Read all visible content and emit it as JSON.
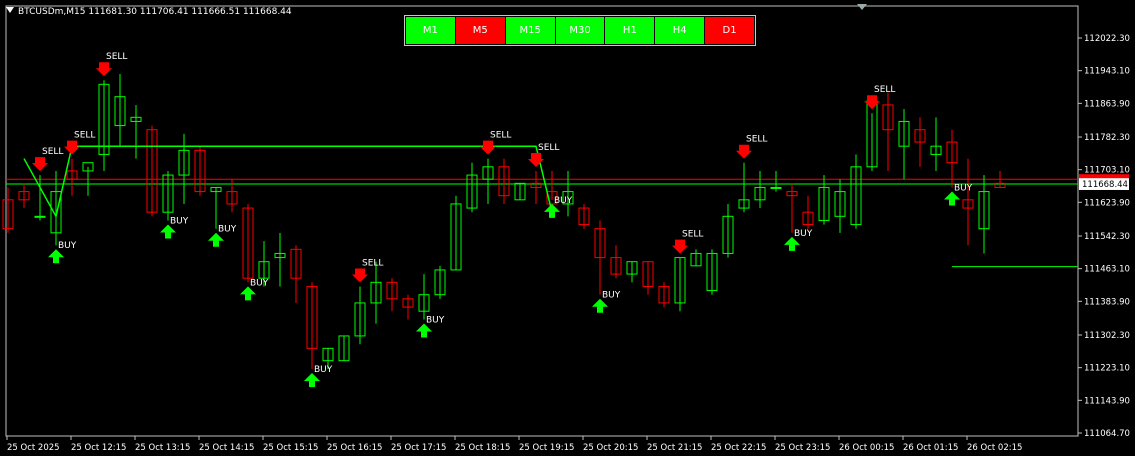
{
  "header": {
    "symbol_info": "BTCUSDm,M15  111681.30 111706.41 111666.51 111668.44"
  },
  "timeframes": [
    {
      "label": "M1",
      "color": "#00ff00"
    },
    {
      "label": "M5",
      "color": "#ff0000"
    },
    {
      "label": "M15",
      "color": "#00ff00"
    },
    {
      "label": "M30",
      "color": "#00ff00"
    },
    {
      "label": "H1",
      "color": "#00ff00"
    },
    {
      "label": "H4",
      "color": "#00ff00"
    },
    {
      "label": "D1",
      "color": "#ff0000"
    }
  ],
  "colors": {
    "background": "#000000",
    "bull": "#00ff00",
    "bear": "#ff0000",
    "buy_arrow": "#00ff00",
    "sell_arrow": "#ff0000",
    "axis": "#c0c0c0",
    "price_line": "#00ff00",
    "bid_line": "#ff0000"
  },
  "chart_data": {
    "type": "candlestick",
    "y_ticks": [
      "112022.30",
      "111943.10",
      "111863.90",
      "111782.30",
      "111703.10",
      "111623.90",
      "111542.30",
      "111463.10",
      "111383.90",
      "111302.30",
      "111223.10",
      "111143.90",
      "111064.70"
    ],
    "x_ticks": [
      "25 Oct 2025",
      "25 Oct 12:15",
      "25 Oct 13:15",
      "25 Oct 14:15",
      "25 Oct 15:15",
      "25 Oct 16:15",
      "25 Oct 17:15",
      "25 Oct 18:15",
      "25 Oct 19:15",
      "25 Oct 20:15",
      "25 Oct 21:15",
      "25 Oct 22:15",
      "25 Oct 23:15",
      "26 Oct 00:15",
      "26 Oct 01:15",
      "26 Oct 02:15"
    ],
    "ylim": [
      111064.7,
      112022.3
    ],
    "current_price": "111668.44",
    "bid_price": "111680",
    "candles": [
      [
        111630,
        111660,
        111550,
        111560
      ],
      [
        111650,
        111670,
        111610,
        111630
      ],
      [
        111590,
        111690,
        111580,
        111590
      ],
      [
        111550,
        111700,
        111520,
        111650
      ],
      [
        111700,
        111730,
        111640,
        111680
      ],
      [
        111700,
        111710,
        111640,
        111720
      ],
      [
        111740,
        111920,
        111700,
        111910
      ],
      [
        111810,
        111935,
        111760,
        111880
      ],
      [
        111820,
        111860,
        111730,
        111830
      ],
      [
        111800,
        111810,
        111590,
        111600
      ],
      [
        111600,
        111700,
        111580,
        111690
      ],
      [
        111690,
        111790,
        111620,
        111750
      ],
      [
        111750,
        111760,
        111640,
        111650
      ],
      [
        111650,
        111660,
        111560,
        111660
      ],
      [
        111650,
        111680,
        111600,
        111620
      ],
      [
        111610,
        111620,
        111430,
        111440
      ],
      [
        111440,
        111530,
        111420,
        111480
      ],
      [
        111490,
        111550,
        111420,
        111500
      ],
      [
        111510,
        111520,
        111380,
        111440
      ],
      [
        111420,
        111430,
        111220,
        111270
      ],
      [
        111240,
        111270,
        111220,
        111270
      ],
      [
        111240,
        111300,
        111240,
        111300
      ],
      [
        111300,
        111420,
        111280,
        111380
      ],
      [
        111380,
        111480,
        111330,
        111430
      ],
      [
        111430,
        111440,
        111360,
        111390
      ],
      [
        111390,
        111400,
        111340,
        111370
      ],
      [
        111360,
        111450,
        111340,
        111400
      ],
      [
        111400,
        111470,
        111390,
        111460
      ],
      [
        111460,
        111640,
        111460,
        111620
      ],
      [
        111610,
        111720,
        111600,
        111690
      ],
      [
        111680,
        111730,
        111620,
        111710
      ],
      [
        111710,
        111730,
        111620,
        111640
      ],
      [
        111630,
        111670,
        111630,
        111670
      ],
      [
        111670,
        111700,
        111620,
        111660
      ],
      [
        111650,
        111700,
        111630,
        111620
      ],
      [
        111620,
        111700,
        111590,
        111650
      ],
      [
        111610,
        111620,
        111560,
        111570
      ],
      [
        111560,
        111580,
        111400,
        111490
      ],
      [
        111490,
        111520,
        111440,
        111450
      ],
      [
        111450,
        111480,
        111430,
        111480
      ],
      [
        111480,
        111480,
        111400,
        111420
      ],
      [
        111420,
        111430,
        111370,
        111380
      ],
      [
        111380,
        111490,
        111360,
        111490
      ],
      [
        111470,
        111510,
        111470,
        111500
      ],
      [
        111410,
        111510,
        111400,
        111500
      ],
      [
        111500,
        111620,
        111490,
        111590
      ],
      [
        111610,
        111720,
        111600,
        111630
      ],
      [
        111630,
        111700,
        111610,
        111660
      ],
      [
        111660,
        111700,
        111650,
        111660
      ],
      [
        111650,
        111670,
        111550,
        111640
      ],
      [
        111600,
        111640,
        111560,
        111570
      ],
      [
        111580,
        111690,
        111570,
        111660
      ],
      [
        111590,
        111680,
        111550,
        111650
      ],
      [
        111570,
        111740,
        111560,
        111710
      ],
      [
        111710,
        111840,
        111700,
        111870
      ],
      [
        111860,
        111890,
        111700,
        111800
      ],
      [
        111760,
        111850,
        111680,
        111820
      ],
      [
        111800,
        111830,
        111710,
        111770
      ],
      [
        111740,
        111830,
        111700,
        111760
      ],
      [
        111770,
        111800,
        111660,
        111720
      ],
      [
        111630,
        111730,
        111520,
        111610
      ],
      [
        111560,
        111690,
        111500,
        111650
      ],
      [
        111670,
        111700,
        111660,
        111660
      ]
    ],
    "signals": [
      {
        "i": 2,
        "type": "sell",
        "label": "SELL"
      },
      {
        "i": 3,
        "type": "buy",
        "label": "BUY"
      },
      {
        "i": 4,
        "type": "sell",
        "label": "SELL"
      },
      {
        "i": 6,
        "type": "sell",
        "label": "SELL"
      },
      {
        "i": 10,
        "type": "buy",
        "label": "BUY"
      },
      {
        "i": 13,
        "type": "buy",
        "label": "BUY"
      },
      {
        "i": 15,
        "type": "buy",
        "label": "BUY"
      },
      {
        "i": 19,
        "type": "buy",
        "label": "BUY"
      },
      {
        "i": 22,
        "type": "sell",
        "label": "SELL"
      },
      {
        "i": 26,
        "type": "buy",
        "label": "BUY"
      },
      {
        "i": 30,
        "type": "sell",
        "label": "SELL"
      },
      {
        "i": 33,
        "type": "sell",
        "label": "SELL"
      },
      {
        "i": 34,
        "type": "buy",
        "label": "BUY"
      },
      {
        "i": 37,
        "type": "buy",
        "label": "BUY"
      },
      {
        "i": 42,
        "type": "sell",
        "label": "SELL"
      },
      {
        "i": 46,
        "type": "sell",
        "label": "SELL"
      },
      {
        "i": 49,
        "type": "buy",
        "label": "BUY"
      },
      {
        "i": 54,
        "type": "sell",
        "label": "SELL"
      },
      {
        "i": 59,
        "type": "buy",
        "label": "BUY"
      }
    ],
    "zigzag": [
      [
        1,
        111730
      ],
      [
        3,
        111590
      ],
      [
        4,
        111760
      ],
      [
        33,
        111760
      ],
      [
        34,
        111600
      ]
    ],
    "buy_level": {
      "start": 59,
      "price": 111468
    }
  }
}
